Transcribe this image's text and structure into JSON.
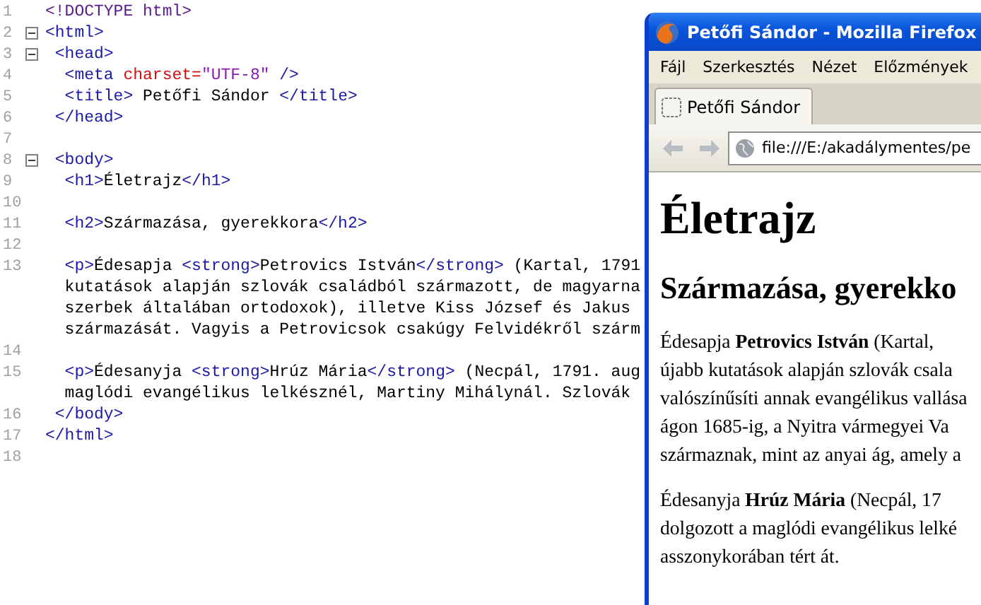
{
  "editor": {
    "lines": [
      {
        "number": "1",
        "foldable": false,
        "rows": [
          [
            {
              "kind": "doctype",
              "text": "<!DOCTYPE html>"
            }
          ]
        ]
      },
      {
        "number": "2",
        "foldable": true,
        "rows": [
          [
            {
              "kind": "tag",
              "text": "<html>"
            }
          ]
        ]
      },
      {
        "number": "3",
        "foldable": true,
        "rows": [
          [
            {
              "kind": "tag",
              "text": " <head>"
            }
          ]
        ]
      },
      {
        "number": "4",
        "foldable": false,
        "rows": [
          [
            {
              "kind": "tag",
              "text": "  <meta "
            },
            {
              "kind": "attr",
              "text": "charset="
            },
            {
              "kind": "string",
              "text": "\"UTF-8\""
            },
            {
              "kind": "tag",
              "text": " />"
            }
          ]
        ]
      },
      {
        "number": "5",
        "foldable": false,
        "rows": [
          [
            {
              "kind": "tag",
              "text": "  <title>"
            },
            {
              "kind": "text",
              "text": " Petőfi Sándor "
            },
            {
              "kind": "tag",
              "text": "</title>"
            }
          ]
        ]
      },
      {
        "number": "6",
        "foldable": false,
        "rows": [
          [
            {
              "kind": "tag",
              "text": " </head>"
            }
          ]
        ]
      },
      {
        "number": "7",
        "foldable": false
      },
      {
        "number": "8",
        "foldable": true,
        "rows": [
          [
            {
              "kind": "tag",
              "text": " <body>"
            }
          ]
        ]
      },
      {
        "number": "9",
        "foldable": false,
        "rows": [
          [
            {
              "kind": "tag",
              "text": "  <h1>"
            },
            {
              "kind": "text",
              "text": "Életrajz"
            },
            {
              "kind": "tag",
              "text": "</h1>"
            }
          ]
        ]
      },
      {
        "number": "10",
        "foldable": false
      },
      {
        "number": "11",
        "foldable": false,
        "rows": [
          [
            {
              "kind": "tag",
              "text": "  <h2>"
            },
            {
              "kind": "text",
              "text": "Származása, gyerekkora"
            },
            {
              "kind": "tag",
              "text": "</h2>"
            }
          ]
        ]
      },
      {
        "number": "12",
        "foldable": false
      },
      {
        "number": "13",
        "foldable": false,
        "rows": [
          [
            {
              "kind": "tag",
              "text": "  <p>"
            },
            {
              "kind": "text",
              "text": "Édesapja "
            },
            {
              "kind": "tag",
              "text": "<strong>"
            },
            {
              "kind": "text",
              "text": "Petrovics István"
            },
            {
              "kind": "tag",
              "text": "</strong>"
            },
            {
              "kind": "text",
              "text": " (Kartal, 1791"
            }
          ],
          [
            {
              "kind": "text",
              "text": "  kutatások alapján szlovák családból származott, de magyarna"
            }
          ],
          [
            {
              "kind": "text",
              "text": "  szerbek általában ortodoxok), illetve Kiss József és Jakus"
            }
          ],
          [
            {
              "kind": "text",
              "text": "  származását. Vagyis a Petrovicsok csakúgy Felvidékről szárm"
            }
          ]
        ]
      },
      {
        "number": "14",
        "foldable": false
      },
      {
        "number": "15",
        "foldable": false,
        "rows": [
          [
            {
              "kind": "tag",
              "text": "  <p>"
            },
            {
              "kind": "text",
              "text": "Édesanyja "
            },
            {
              "kind": "tag",
              "text": "<strong>"
            },
            {
              "kind": "text",
              "text": "Hrúz Mária"
            },
            {
              "kind": "tag",
              "text": "</strong>"
            },
            {
              "kind": "text",
              "text": " (Necpál, 1791. aug"
            }
          ],
          [
            {
              "kind": "text",
              "text": "  maglódi evangélikus lelkésznél, Martiny Mihálynál. Szlovák"
            }
          ]
        ]
      },
      {
        "number": "16",
        "foldable": false,
        "rows": [
          [
            {
              "kind": "tag",
              "text": " </body>"
            }
          ]
        ]
      },
      {
        "number": "17",
        "foldable": false,
        "rows": [
          [
            {
              "kind": "tag",
              "text": "</html>"
            }
          ]
        ]
      },
      {
        "number": "18",
        "foldable": false
      }
    ]
  },
  "browser": {
    "window": {
      "title": "Petőfi Sándor - Mozilla Firefox"
    },
    "menu": [
      "Fájl",
      "Szerkesztés",
      "Nézet",
      "Előzmények"
    ],
    "tab": {
      "label": "Petőfi Sándor"
    },
    "address": {
      "value": "file:///E:/akadálymentes/pe"
    },
    "page": {
      "h1": "Életrajz",
      "h2": "Származása, gyerekko",
      "paragraphs": [
        [
          "Édesapja **Petrovics István** (Kartal,",
          "újabb kutatások alapján szlovák csala",
          "valószínűsíti annak evangélikus vallása",
          "ágon 1685-ig, a Nyitra vármegyei Va",
          "származnak, mint az anyai ág, amely a"
        ],
        [
          "Édesanyja **Hrúz Mária** (Necpál, 17",
          "dolgozott a maglódi evangélikus lelké",
          "asszonykorában tért át."
        ]
      ]
    }
  }
}
